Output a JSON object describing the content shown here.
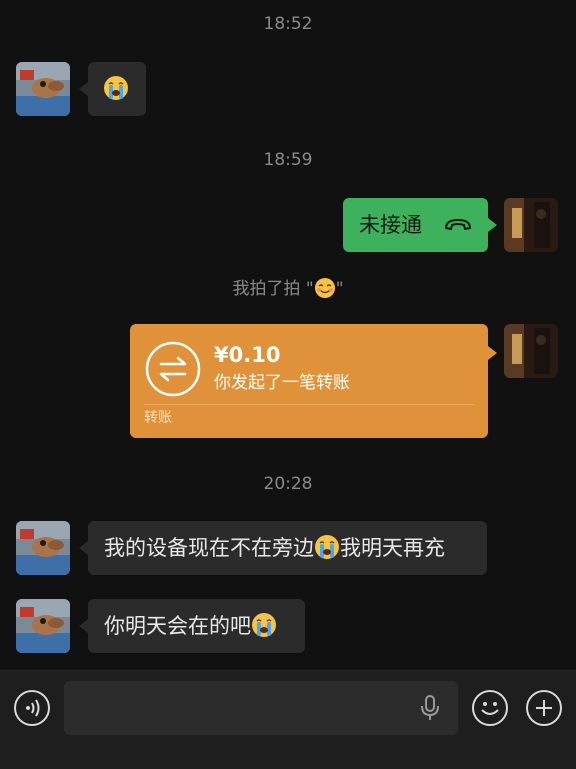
{
  "timestamps": [
    "18:52",
    "18:59",
    "20:28"
  ],
  "messages": {
    "m1_emoji": "crying-face",
    "call": {
      "label": "未接通",
      "icon": "phone-hangup-icon"
    },
    "poke": {
      "prefix": "我拍了拍 \"",
      "suffix": "\"",
      "emoji": "smiling-face"
    },
    "transfer": {
      "amount": "¥0.10",
      "desc": "你发起了一笔转账",
      "footer": "转账",
      "icon": "transfer-arrows-icon",
      "color": "#e0923a"
    },
    "m4": {
      "text_before": "我的设备现在不在旁边",
      "text_after": "我明天再充",
      "emoji": "crying-face"
    },
    "m5": {
      "text": "你明天会在的吧",
      "emoji": "crying-face"
    }
  },
  "bottom_bar": {
    "input_value": "",
    "icons": [
      "voice-icon",
      "mic-icon",
      "emoji-icon",
      "plus-icon"
    ]
  },
  "colors": {
    "green_bubble": "#3db15c",
    "orange_bubble": "#e0923a",
    "background": "#111111"
  }
}
